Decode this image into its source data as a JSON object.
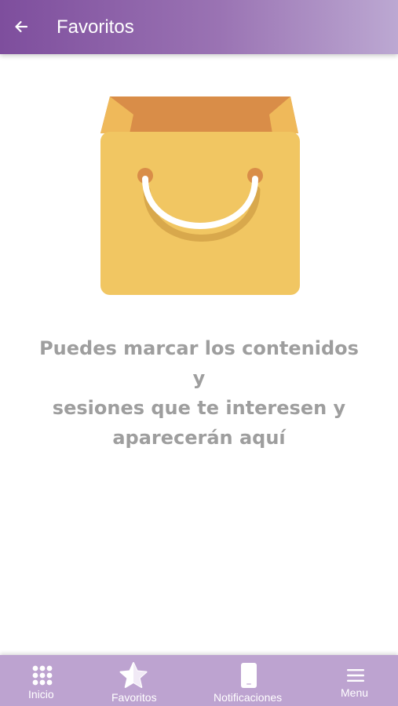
{
  "header": {
    "title": "Favoritos",
    "back_icon": "arrow-left-icon",
    "gradient": [
      "#7e4e9d",
      "#bca8d2"
    ]
  },
  "empty_state": {
    "illustration": "shopping-bag-icon",
    "message_lines": [
      "Puedes marcar los contenidos y",
      "sesiones que te interesen y",
      "aparecerán aquí"
    ]
  },
  "bottom_nav": {
    "background": "#bda3d0",
    "items": [
      {
        "label": "Inicio",
        "icon": "grid-dots-icon"
      },
      {
        "label": "Favoritos",
        "icon": "star-icon"
      },
      {
        "label": "Notificaciones",
        "icon": "phone-icon"
      },
      {
        "label": "Menu",
        "icon": "hamburger-menu-icon"
      }
    ]
  }
}
